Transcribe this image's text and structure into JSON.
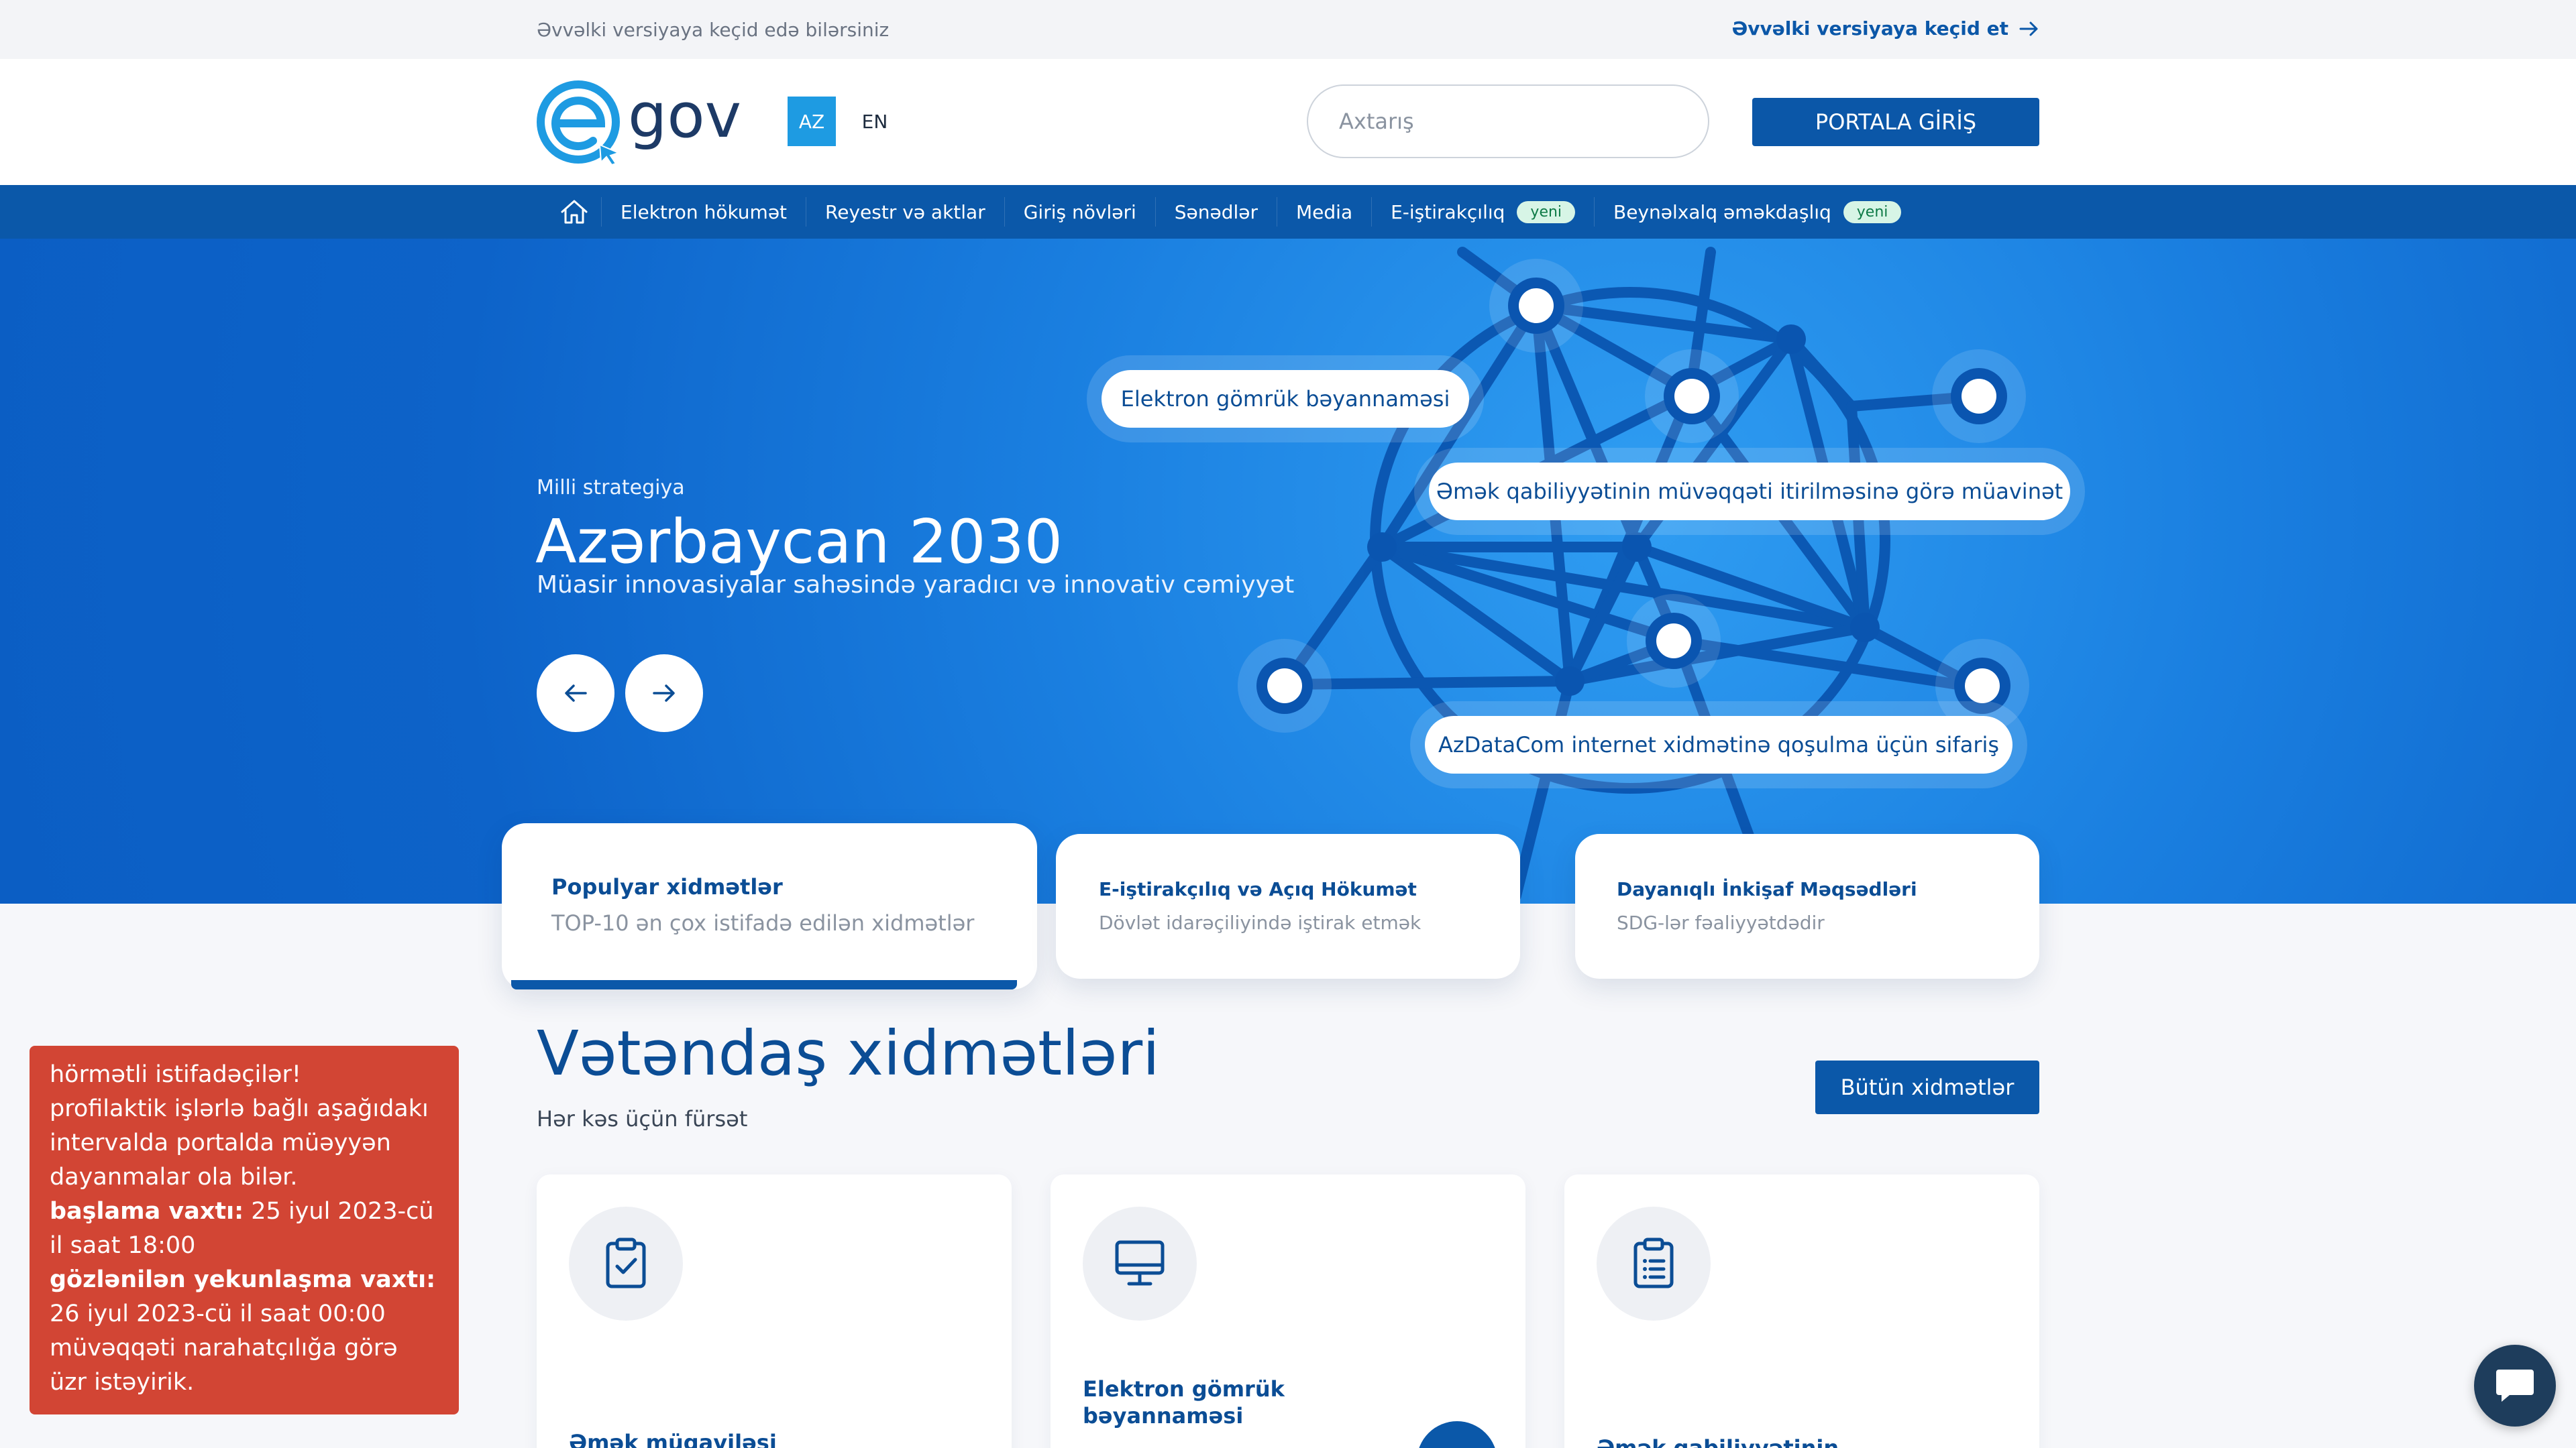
{
  "topbar": {
    "message": "Əvvəlki versiyaya keçid edə bilərsiniz",
    "link_label": "Əvvəlki versiyaya keçid et"
  },
  "header": {
    "logo_text": "egov",
    "lang_az": "AZ",
    "lang_en": "EN",
    "search_placeholder": "Axtarış",
    "login_label": "PORTALA GİRİŞ"
  },
  "nav": {
    "items": [
      {
        "label": "Elektron hökumət"
      },
      {
        "label": "Reyestr və aktlar"
      },
      {
        "label": "Giriş növləri"
      },
      {
        "label": "Sənədlər"
      },
      {
        "label": "Media"
      },
      {
        "label": "E-iştirakçılıq",
        "badge": "yeni"
      },
      {
        "label": "Beynəlxalq əməkdaşlıq",
        "badge": "yeni"
      }
    ]
  },
  "hero": {
    "kicker": "Milli strategiya",
    "title": "Azərbaycan 2030",
    "subtitle": "Müasir innovasiyalar sahəsində yaradıcı və innovativ cəmiyyət",
    "pills": [
      "Elektron gömrük bəyannaməsi",
      "Əmək qabiliyyətinin müvəqqəti itirilməsinə görə müavinət",
      "AzDataCom internet xidmətinə qoşulma üçün sifariş"
    ]
  },
  "categories": [
    {
      "title": "Populyar xidmətlər",
      "subtitle": "TOP-10 ən çox istifadə edilən xidmətlər"
    },
    {
      "title": "E-iştirakçılıq və Açıq Hökumət",
      "subtitle": "Dövlət idarəçiliyində iştirak etmək"
    },
    {
      "title": "Dayanıqlı İnkişaf Məqsədləri",
      "subtitle": "SDG-lər fəaliyyətdədir"
    }
  ],
  "services": {
    "title": "Vətəndaş xidmətləri",
    "subtitle": "Hər kəs üçün fürsət",
    "all_label": "Bütün xidmətlər",
    "cards": [
      {
        "title": "Əmək müqaviləsi bildirişləri",
        "icon": "clipboard-check-icon"
      },
      {
        "title": "Elektron gömrük bəyannaməsi",
        "icon": "monitor-icon"
      },
      {
        "title": "Əmək qabiliyyətinin",
        "icon": "clipboard-list-icon"
      }
    ]
  },
  "notice": {
    "line1": "hörmətli istifadəçilər!",
    "line2": "profilaktik işlərlə bağlı aşağıdakı intervalda portalda müəyyən dayanmalar ola bilər.",
    "start_label": "başlama vaxtı:",
    "start_value": "25 iyul 2023-cü il saat 18:00",
    "end_label": "gözlənilən yekunlaşma vaxtı:",
    "end_value": "26 iyul 2023-cü il saat 00:00",
    "line_last": "müvəqqəti narahatçılığa görə üzr istəyirik."
  },
  "colors": {
    "brand": "#0b58a9",
    "accent": "#1e9be2",
    "notice": "#d24534"
  }
}
